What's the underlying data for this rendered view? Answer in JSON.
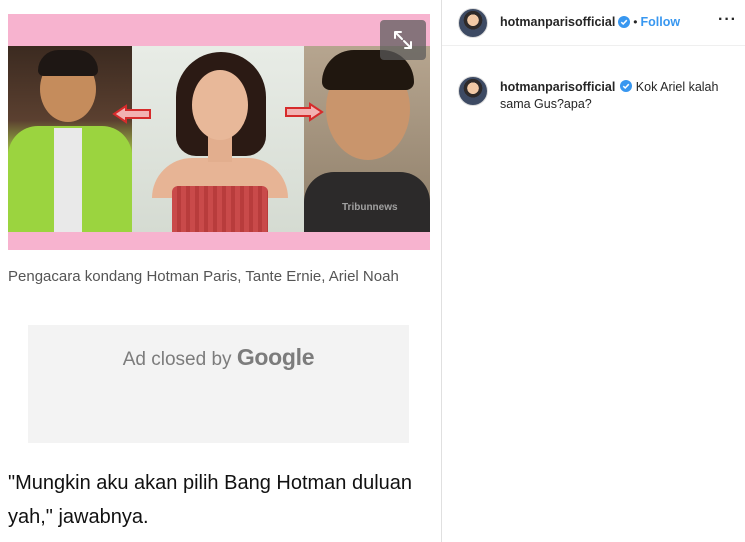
{
  "article": {
    "caption": "Pengacara kondang Hotman Paris, Tante Ernie, Ariel Noah",
    "ad": {
      "prefix": "Ad closed by",
      "brand": "Google"
    },
    "quote": "\"Mungkin aku akan pilih Bang Hotman duluan yah,\" jawabnya.",
    "image": {
      "watermark": "Tribunnews"
    }
  },
  "instagram": {
    "header": {
      "username": "hotmanparisofficial",
      "separator": "•",
      "follow_label": "Follow",
      "more_label": "···"
    },
    "comment": {
      "username": "hotmanparisofficial",
      "text": "Kok Ariel kalah sama Gus?apa?"
    }
  },
  "colors": {
    "frame_pink": "#f7b3cf",
    "follow_blue": "#3897f0",
    "verified_blue": "#3897f0"
  }
}
